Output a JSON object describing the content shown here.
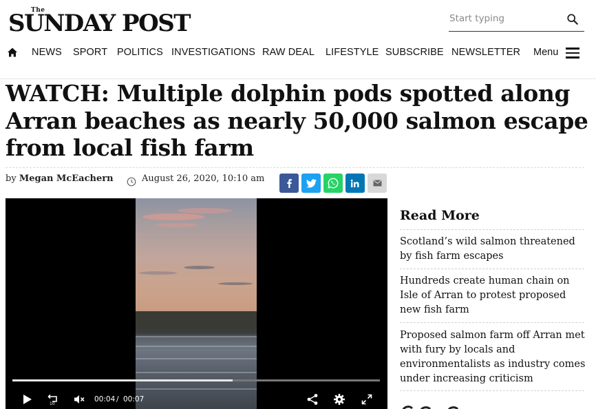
{
  "header": {
    "logo_the": "The",
    "logo_text": "SUNDAY POST",
    "search_placeholder": "Start typing"
  },
  "nav": {
    "items": [
      "NEWS",
      "SPORT",
      "POLITICS",
      "INVESTIGATIONS",
      "RAW DEAL",
      "LIFESTYLE",
      "SUBSCRIBE",
      "NEWSLETTER"
    ],
    "menu_label": "Menu"
  },
  "article": {
    "headline": "WATCH: Multiple dolphin pods spotted along Arran beaches as nearly 50,000 salmon escape from local fish farm",
    "byline_prefix": "by",
    "author": "Megan McEachern",
    "date": "August 26, 2020, 10:10 am"
  },
  "share": {
    "colors": {
      "facebook": "#3b5998",
      "twitter": "#1da1f2",
      "whatsapp": "#25d366",
      "linkedin": "#0077b5",
      "email": "#d8d8d8"
    }
  },
  "video": {
    "current_time": "00:04",
    "separator": "/",
    "duration": "00:07",
    "progress_fraction": 0.6
  },
  "sidebar": {
    "title": "Read More",
    "items": [
      "Scotland’s wild salmon threatened by fish farm escapes",
      "Hundreds create human chain on Isle of Arran to protest proposed new fish farm",
      "Proposed salmon farm off Arran met with fury by locals and environmentalists as industry comes under increasing criticism"
    ]
  }
}
